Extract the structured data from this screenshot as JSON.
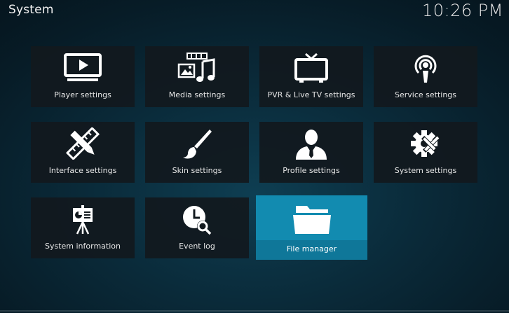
{
  "header": {
    "title": "System",
    "clock": "10:26 PM"
  },
  "tiles": [
    {
      "label": "Player settings",
      "icon": "monitor-play-icon"
    },
    {
      "label": "Media settings",
      "icon": "media-icon"
    },
    {
      "label": "PVR & Live TV settings",
      "icon": "tv-antenna-icon"
    },
    {
      "label": "Service settings",
      "icon": "podcast-icon"
    },
    {
      "label": "Interface settings",
      "icon": "pencil-ruler-icon"
    },
    {
      "label": "Skin settings",
      "icon": "paintbrush-icon"
    },
    {
      "label": "Profile settings",
      "icon": "user-profile-icon"
    },
    {
      "label": "System settings",
      "icon": "gear-wrench-icon"
    },
    {
      "label": "System information",
      "icon": "presentation-board-icon"
    },
    {
      "label": "Event log",
      "icon": "clock-search-icon"
    },
    {
      "label": "File manager",
      "icon": "folder-icon",
      "focused": true
    }
  ],
  "colors": {
    "accent": "#128bb0",
    "tile_bg": "#12191e"
  }
}
